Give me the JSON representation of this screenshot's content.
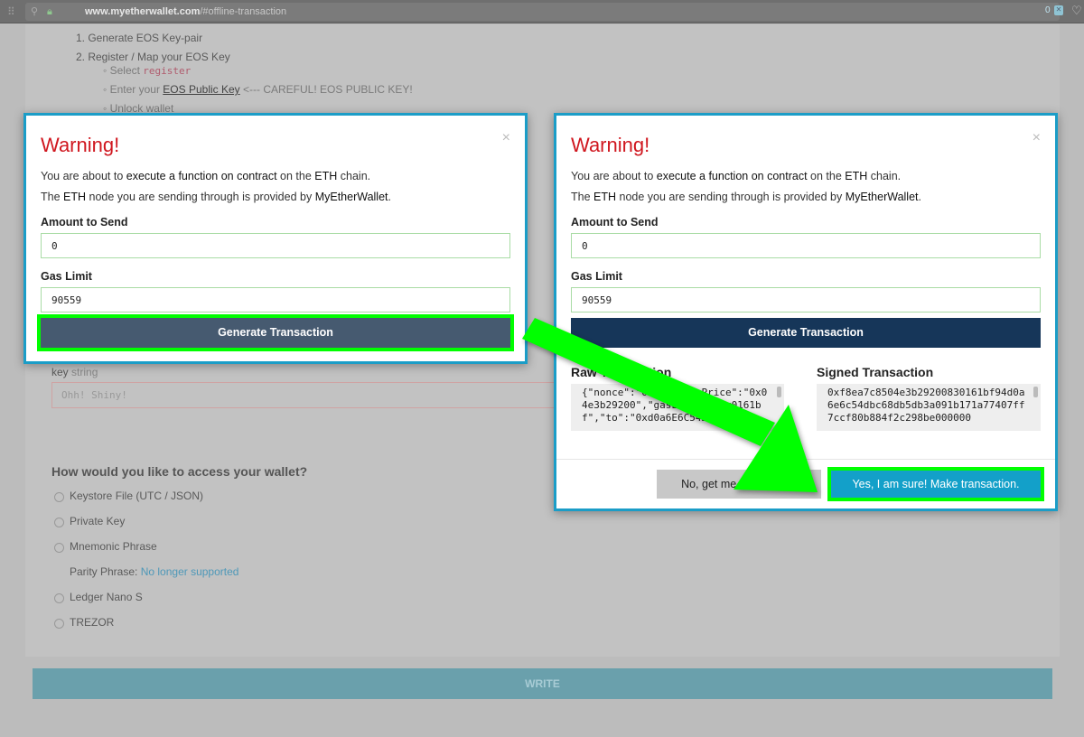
{
  "browser": {
    "url_host": "www.myetherwallet.com",
    "url_path": "/#offline-transaction",
    "badge_count": "0"
  },
  "background": {
    "steps": [
      "1. Generate EOS Key-pair",
      "2. Register / Map your EOS Key"
    ],
    "substeps": {
      "select_prefix": "Select",
      "select_code": "register",
      "enter_prefix": "Enter your",
      "enter_link": "EOS Public Key",
      "enter_suffix": "<--- CAREFUL! EOS PUBLIC KEY!",
      "unlock": "Unlock wallet"
    },
    "key_label": "key",
    "key_type": "string",
    "key_placeholder": "Ohh! Shiny!",
    "access_title": "How would you like to access your wallet?",
    "access_options": [
      "Keystore File (UTC / JSON)",
      "Private Key",
      "Mnemonic Phrase",
      "Ledger Nano S",
      "TREZOR"
    ],
    "parity_label": "Parity Phrase:",
    "parity_link": "No longer supported",
    "write_button": "WRITE"
  },
  "modal": {
    "title": "Warning!",
    "close": "×",
    "line1": {
      "a": "You are about to",
      "b": "execute a function on contract",
      "c": "on the",
      "d": "ETH",
      "e": "chain."
    },
    "line2": {
      "a": "The",
      "b": "ETH",
      "c": "node you are sending through is provided by",
      "d": "MyEtherWallet",
      "e": "."
    },
    "amount_label": "Amount to Send",
    "amount_value": "0",
    "gas_label": "Gas Limit",
    "gas_value": "90559",
    "generate_button": "Generate Transaction",
    "raw_label": "Raw Transaction",
    "raw_value": "{\"nonce\":\"0x7c\",\"gasPrice\":\"0x04e3b29200\",\"gasLimit\":\"0x0161bf\",\"to\":\"0xd0a6E6C54DbC68Db5d",
    "signed_label": "Signed Transaction",
    "signed_value": "0xf8ea7c8504e3b29200830161bf94d0a6e6c54dbc68db5db3a091b171a77407ff7ccf80b884f2c298be000000",
    "no_button": "No, get me out of here!",
    "yes_button": "Yes, I am sure! Make transaction."
  },
  "colors": {
    "warning": "#d0171f",
    "highlight": "#00ff00",
    "modal_border": "#1b9dc7",
    "yes": "#13a0c9",
    "generate": "#163659"
  }
}
